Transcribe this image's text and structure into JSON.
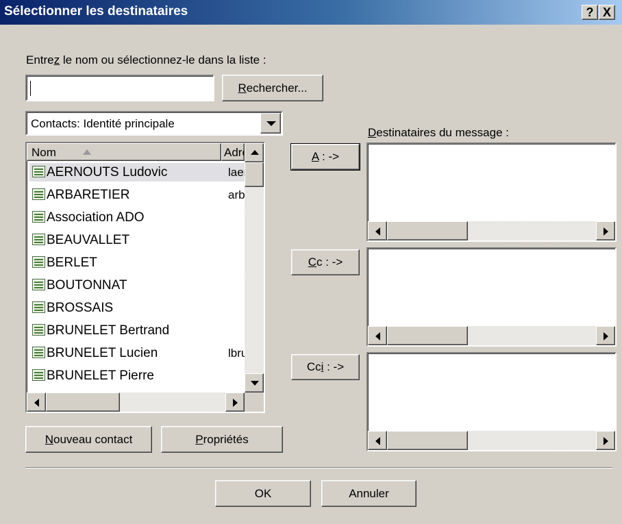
{
  "window": {
    "title": "Sélectionner les destinataires",
    "help_button": "?",
    "close_button": "X"
  },
  "search": {
    "prompt_before": "Entre",
    "prompt_accel": "z",
    "prompt_after": " le nom ou sélectionnez-le dans la liste :",
    "input_value": "",
    "button_accel": "R",
    "button_rest": "echercher..."
  },
  "addressbook": {
    "selected": "Contacts: Identité principale"
  },
  "contacts_list": {
    "columns": [
      {
        "label": "Nom"
      },
      {
        "label": "Adre:"
      }
    ],
    "rows": [
      {
        "name": "AERNOUTS Ludovic",
        "address": "laern"
      },
      {
        "name": "ARBARETIER",
        "address": "arbar"
      },
      {
        "name": "Association ADO",
        "address": ""
      },
      {
        "name": "BEAUVALLET",
        "address": ""
      },
      {
        "name": "BERLET",
        "address": ""
      },
      {
        "name": "BOUTONNAT",
        "address": ""
      },
      {
        "name": "BROSSAIS",
        "address": ""
      },
      {
        "name": "BRUNELET Bertrand",
        "address": ""
      },
      {
        "name": "BRUNELET Lucien",
        "address": "lbrun"
      },
      {
        "name": "BRUNELET Pierre",
        "address": ""
      }
    ]
  },
  "recipients": {
    "label_accel": "D",
    "label_rest": "estinataires du message :",
    "to_accel": "A",
    "to_rest": " : ->",
    "cc_accel": "C",
    "cc_rest": "c : ->",
    "bcc_before": "Cc",
    "bcc_accel": "i",
    "bcc_rest": " : ->"
  },
  "actions": {
    "new_contact_accel": "N",
    "new_contact_rest": "ouveau contact",
    "properties_accel": "P",
    "properties_rest": "ropriétés",
    "ok": "OK",
    "cancel": "Annuler"
  },
  "colors": {
    "titlebar_start": "#0a246a",
    "titlebar_end": "#a6caf0",
    "face": "#d4d0c8"
  }
}
